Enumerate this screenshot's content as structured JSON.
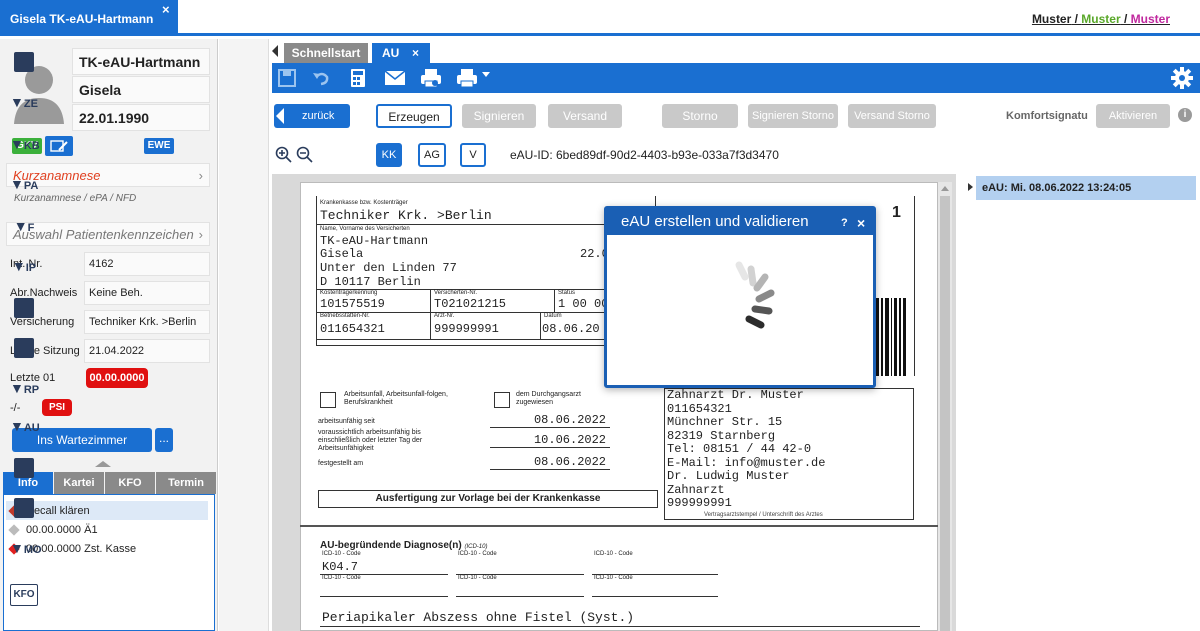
{
  "top": {
    "patient_tab": "Gisela TK-eAU-Hartmann",
    "close": "×",
    "muster_1": "Muster",
    "sep_1": " / ",
    "muster_2": "Muster",
    "sep_2": " / ",
    "muster_3": "Muster",
    "colors": {
      "muster_1": "#222222",
      "muster_2": "#5aa82a",
      "muster_3": "#c0289e"
    }
  },
  "patient": {
    "lastname": "TK-eAU-Hartmann",
    "firstname": "Gisela",
    "dob": "22.01.1990",
    "badge_gkv": "GKV",
    "badge_ewe": "EWE",
    "kurzanamnese": "Kurzanamnese",
    "kurz_sub": "Kurzanamnese  /  ePA  /  NFD",
    "auswahl": "Auswahl Patientenkennzeichen",
    "info": [
      {
        "label": "Int. Nr.",
        "value": "4162"
      },
      {
        "label": "Abr.Nachweis",
        "value": "Keine Beh."
      },
      {
        "label": "Versicherung",
        "value": "Techniker Krk. >Berlin"
      },
      {
        "label": "Letzte Sitzung",
        "value": "21.04.2022"
      }
    ],
    "letzte01_label": "Letzte 01",
    "letzte01_value": "00.00.0000",
    "psi_prefix": "-/-",
    "psi": "PSI",
    "wartezimmer": "Ins Wartezimmer",
    "more": "..."
  },
  "left_tabs": [
    "Info",
    "Kartei",
    "KFO",
    "Termin"
  ],
  "left_list": [
    {
      "text": "Recall klären",
      "color": "#c0392b"
    },
    {
      "text": "00.00.0000 Ä1",
      "color": "#bbbbbb"
    },
    {
      "text": "00.00.0000 Zst. Kasse",
      "color": "#e02020"
    }
  ],
  "icon_strip": [
    "ZE",
    "KB",
    "PA",
    "F",
    "IP",
    "",
    "",
    "RP",
    "AU",
    "",
    "",
    "MO",
    "KFO"
  ],
  "tabs": {
    "schnellstart": "Schnellstart",
    "au": "AU",
    "au_close": "×"
  },
  "buttons": {
    "zurueck": "zurück",
    "erzeugen": "Erzeugen",
    "signieren": "Signieren",
    "versand": "Versand",
    "storno": "Storno",
    "signieren_storno": "Signieren Storno",
    "versand_storno": "Versand Storno",
    "komfort_label": "Komfortsignatu",
    "aktivieren": "Aktivieren"
  },
  "toggles": {
    "kk": "KK",
    "ag": "AG",
    "v": "V"
  },
  "eau_id": "eAU-ID: 6bed89df-90d2-4403-b93e-033a7f3d3470",
  "doc": {
    "kk_label": "Krankenkasse bzw. Kostenträger",
    "kk": "Techniker Krk. >Berlin",
    "name_label": "Name, Vorname des Versicherten",
    "name1": "TK-eAU-Hartmann",
    "name2": "Gisela",
    "dob_partial": "22.0",
    "street": "Unter den Linden 77",
    "city": "D 10117 Berlin",
    "kt_label": "Kostenträgerkennung",
    "kt": "101575519",
    "vnr_label": "Versicherten-Nr.",
    "vnr": "T021021215",
    "status_label": "Status",
    "status": "1 00 00",
    "bsnr_label": "Betriebsstätten-Nr.",
    "bsnr": "011654321",
    "arzt_label": "Arzt-Nr.",
    "arzt": "999999991",
    "datum_label": "Datum",
    "datum": "08.06.20",
    "page_no": "1",
    "arbeitsunfall": "Arbeitsunfall, Arbeitsunfall-folgen, Berufskrankheit",
    "durchgangsarzt": "dem Durchgangsarzt zugewiesen",
    "au_seit_label": "arbeitsunfähig seit",
    "au_seit": "08.06.2022",
    "au_bis_label": "voraussichtlich arbeitsunfähig bis einschließlich oder letzter Tag der Arbeitsunfähigkeit",
    "au_bis": "10.06.2022",
    "festgestellt_label": "festgestellt am",
    "festgestellt": "08.06.2022",
    "stamp": [
      "Zahnarzt Dr. Muster",
      "011654321",
      "Münchner Str.  15",
      "82319 Starnberg",
      "Tel: 08151 / 44 42-0",
      "E-Mail: info@muster.de",
      "Dr. Ludwig Muster",
      "Zahnarzt",
      "999999991"
    ],
    "stamp_caption": "Vertragsarztstempel / Unterschrift des Arztes",
    "ausfertigung": "Ausfertigung zur Vorlage bei der Krankenkasse",
    "diag_title": "AU-begründende Diagnose(n)",
    "diag_sub": "(ICD-10)",
    "icd_label": "ICD-10 - Code",
    "icd1": "K04.7",
    "diag_text": "Periapikaler Abszess ohne Fistel (Syst.)"
  },
  "modal": {
    "title": "eAU erstellen und validieren",
    "help": "?",
    "close": "×"
  },
  "right_panel": {
    "item": "eAU: Mi. 08.06.2022 13:24:05"
  }
}
